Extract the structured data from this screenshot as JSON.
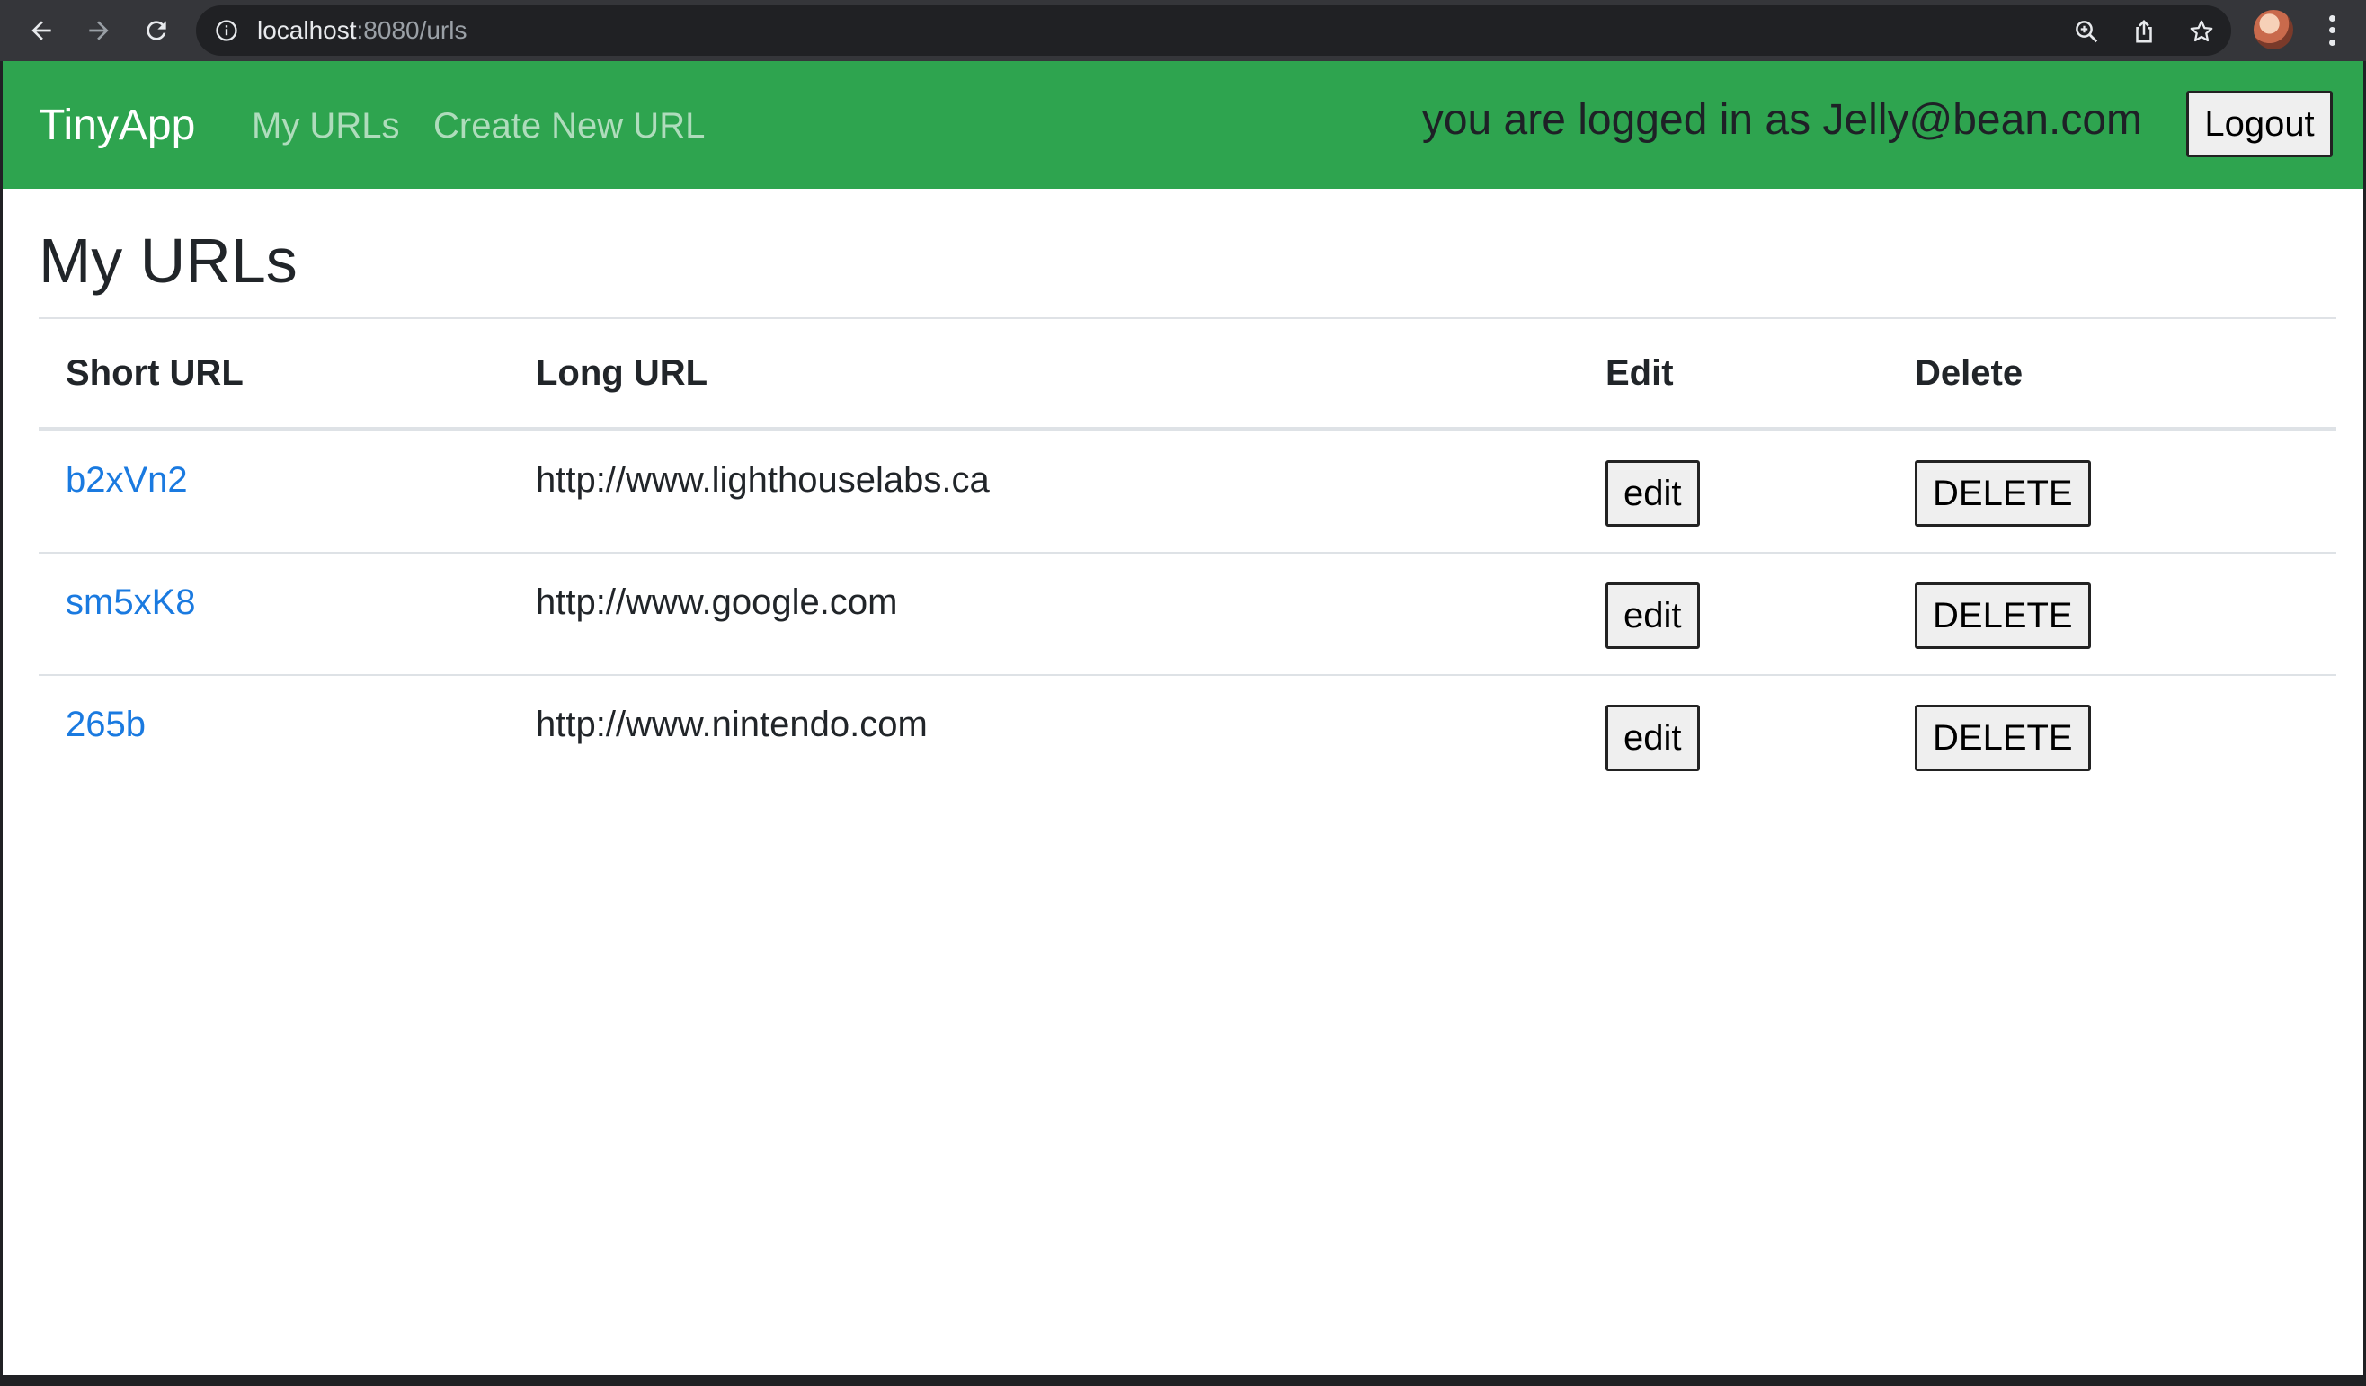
{
  "browser": {
    "url_host": "localhost",
    "url_path": ":8080/urls",
    "back_icon": "arrow-left-icon",
    "forward_icon": "arrow-right-icon",
    "reload_icon": "reload-icon",
    "info_icon": "info-icon",
    "zoom_icon": "zoom-icon",
    "share_icon": "share-icon",
    "bookmark_icon": "star-icon",
    "menu_icon": "kebab-menu-icon",
    "chrome_color": "#35363a",
    "omnibox_color": "#202124"
  },
  "navbar": {
    "brand": "TinyApp",
    "links": [
      "My URLs",
      "Create New URL"
    ],
    "logged_in_text": "you are logged in as Jelly@bean.com",
    "logout_label": "Logout",
    "background_color": "#2ea44f"
  },
  "main": {
    "title": "My URLs",
    "table": {
      "headers": [
        "Short URL",
        "Long URL",
        "Edit",
        "Delete"
      ],
      "rows": [
        {
          "short": "b2xVn2",
          "long": "http://www.lighthouselabs.ca",
          "edit_label": "edit",
          "delete_label": "DELETE"
        },
        {
          "short": "sm5xK8",
          "long": "http://www.google.com",
          "edit_label": "edit",
          "delete_label": "DELETE"
        },
        {
          "short": "265b",
          "long": "http://www.nintendo.com",
          "edit_label": "edit",
          "delete_label": "DELETE"
        }
      ]
    },
    "link_color": "#1a7ae0"
  }
}
